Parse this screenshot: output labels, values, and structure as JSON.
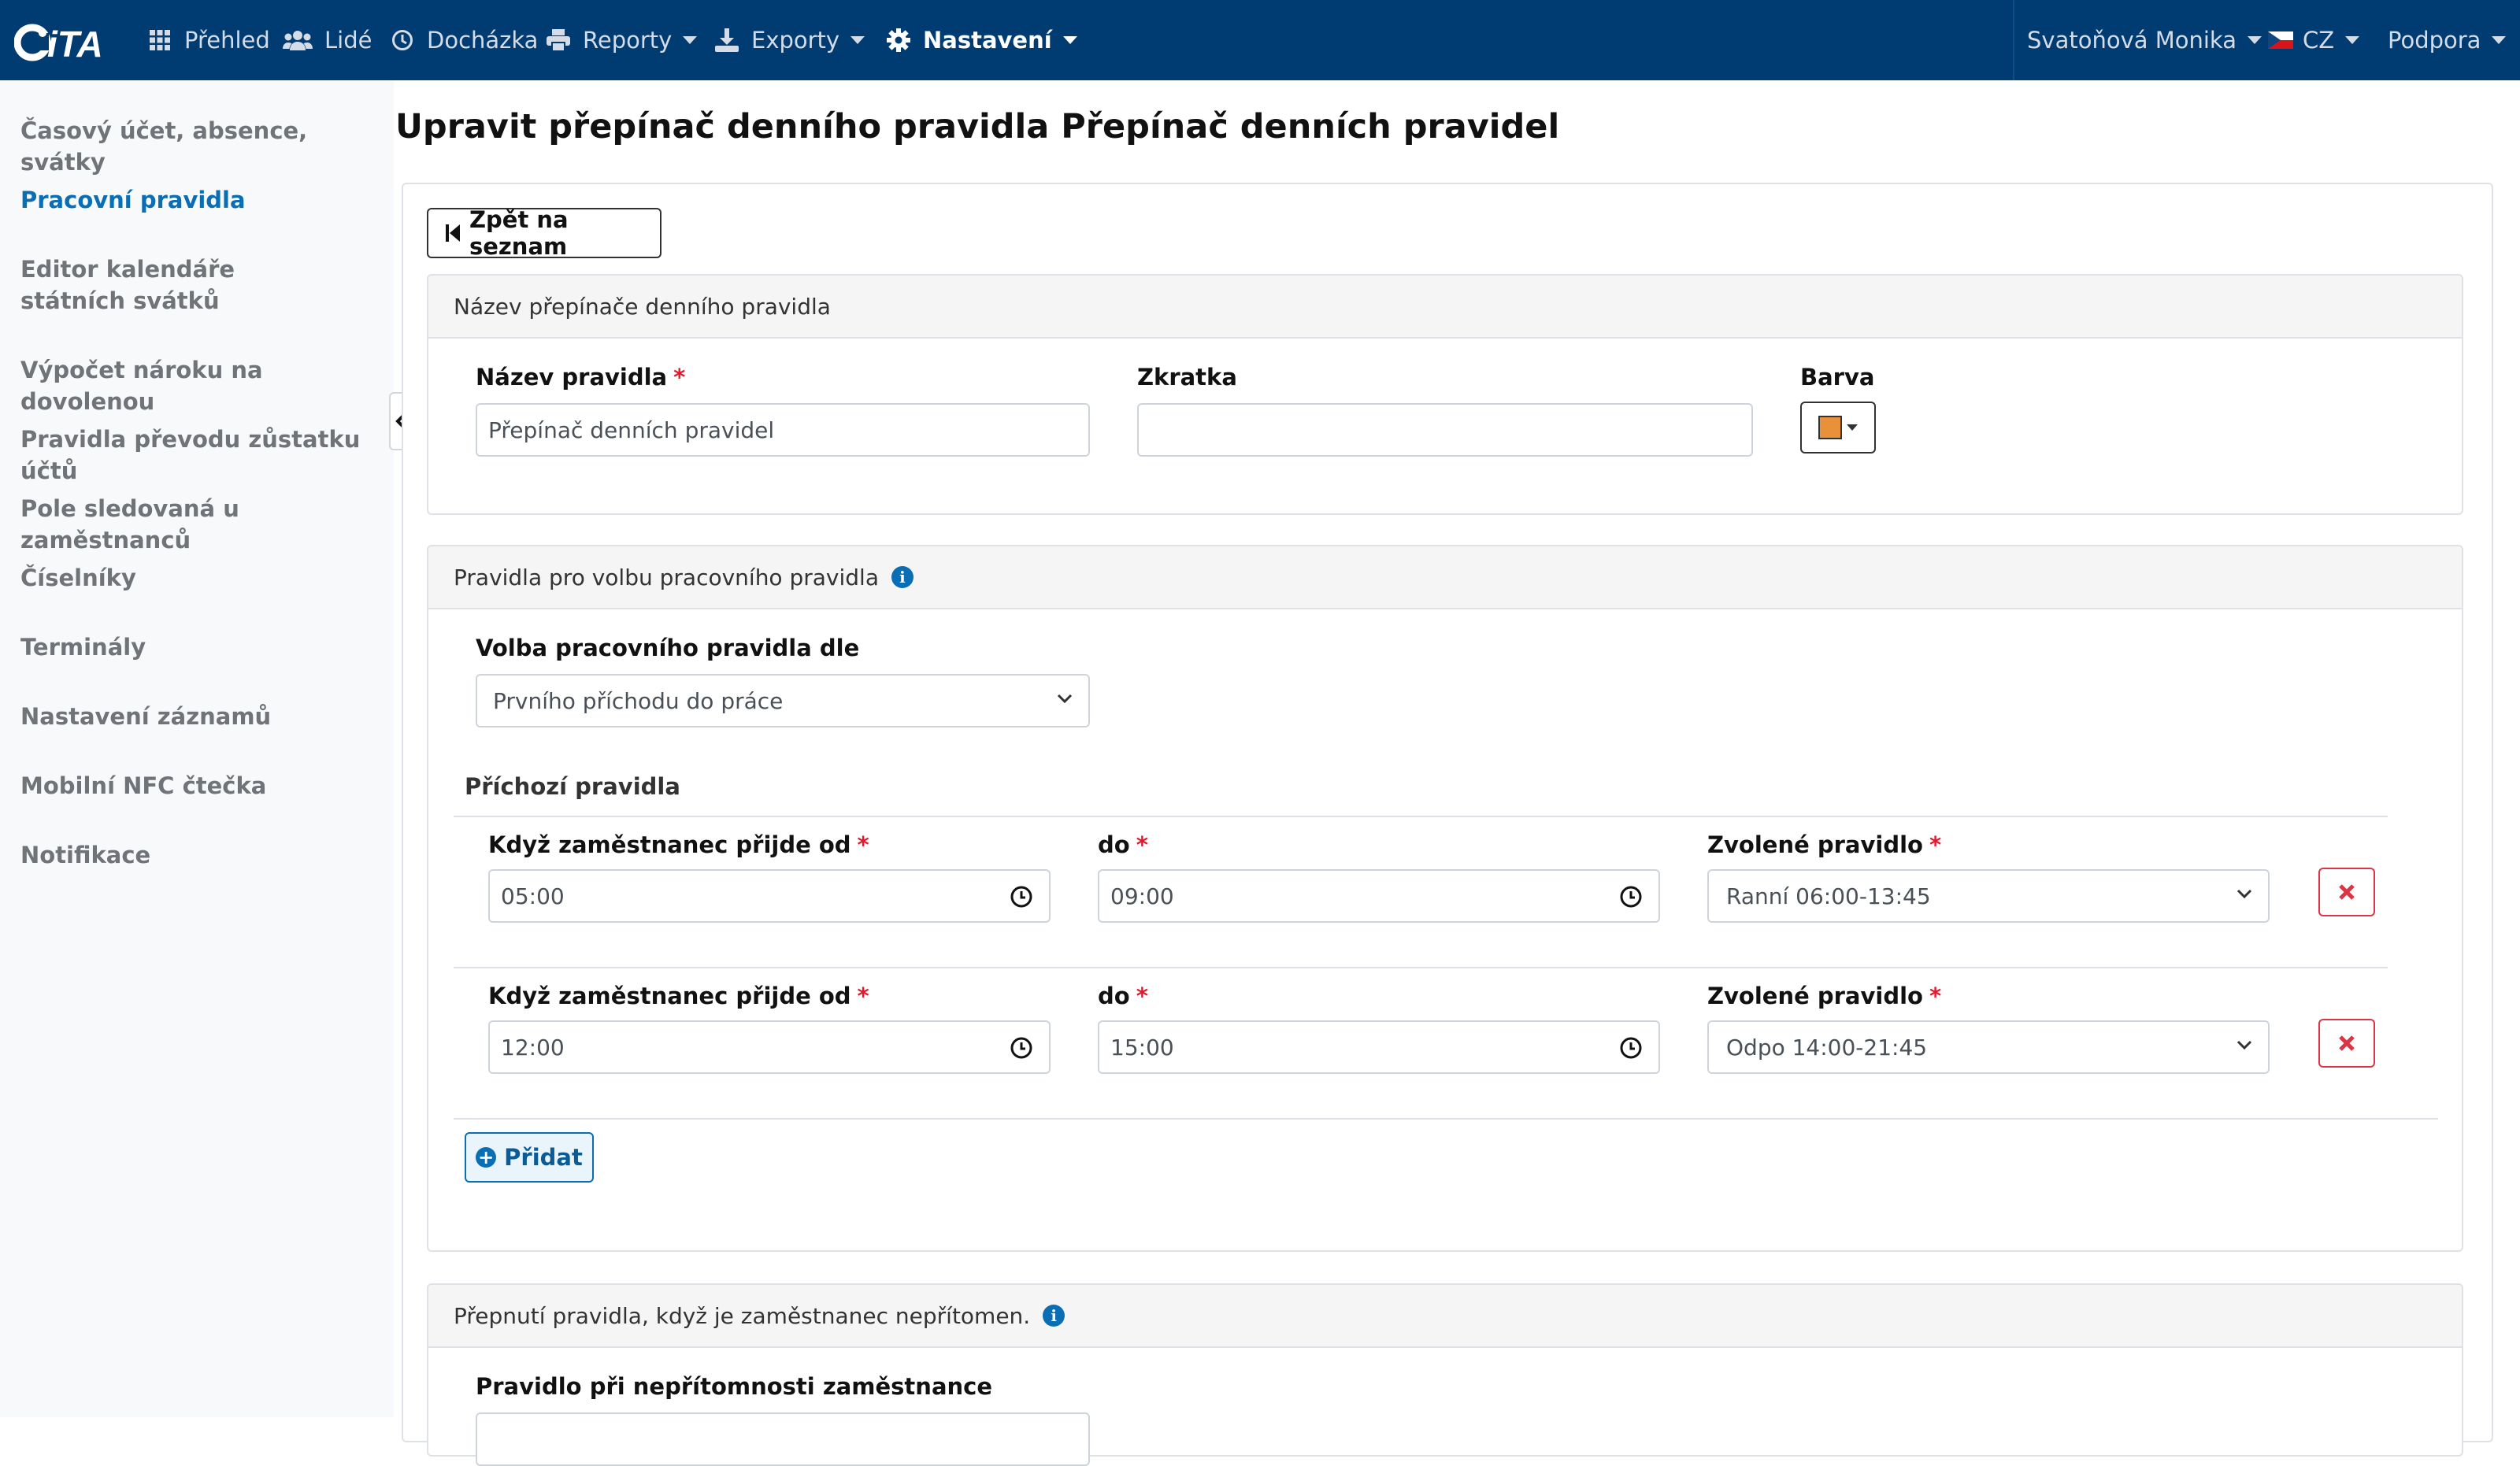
{
  "app": {
    "logo_text": "iTA"
  },
  "nav": {
    "items": [
      {
        "label": "Přehled",
        "icon": "grid-icon"
      },
      {
        "label": "Lidé",
        "icon": "users-icon"
      },
      {
        "label": "Docházka",
        "icon": "clock-icon"
      },
      {
        "label": "Reporty",
        "icon": "print-icon"
      },
      {
        "label": "Exporty",
        "icon": "export-icon"
      },
      {
        "label": "Nastavení",
        "icon": "gear-icon",
        "active": true
      }
    ],
    "user": "Svatoňová Monika",
    "language": "CZ",
    "support": "Podpora"
  },
  "sidebar": {
    "items": [
      {
        "label": "Časový účet, absence, svátky"
      },
      {
        "label": "Pracovní pravidla",
        "active": true
      },
      {
        "label": "Editor kalendáře státních svátků"
      },
      {
        "label": "Výpočet nároku na dovolenou"
      },
      {
        "label": "Pravidla převodu zůstatku účtů"
      },
      {
        "label": "Pole sledovaná u zaměstnanců"
      },
      {
        "label": "Číselníky"
      },
      {
        "label": "Terminály"
      },
      {
        "label": "Nastavení záznamů"
      },
      {
        "label": "Mobilní NFC čtečka"
      },
      {
        "label": "Notifikace"
      }
    ]
  },
  "page": {
    "title": "Upravit přepínač denního pravidla Přepínač denních pravidel",
    "back_button": "Zpět na seznam"
  },
  "name_panel": {
    "header": "Název přepínače denního pravidla",
    "name_label": "Název pravidla",
    "name_value": "Přepínač denních pravidel",
    "abbr_label": "Zkratka",
    "abbr_value": "",
    "color_label": "Barva",
    "color_value": "#e8913a"
  },
  "rules_panel": {
    "header": "Pravidla pro volbu pracovního pravidla",
    "choice_label": "Volba pracovního pravidla dle",
    "choice_value": "Prvního příchodu do práce",
    "arrival_title": "Příchozí pravidla",
    "rows": [
      {
        "from_label": "Když zaměstnanec přijde od",
        "from": "05:00",
        "to_label": "do",
        "to": "09:00",
        "rule_label": "Zvolené pravidlo",
        "rule": "Ranní 06:00-13:45"
      },
      {
        "from_label": "Když zaměstnanec přijde od",
        "from": "12:00",
        "to_label": "do",
        "to": "15:00",
        "rule_label": "Zvolené pravidlo",
        "rule": "Odpo 14:00-21:45"
      }
    ],
    "add_button": "Přidat"
  },
  "absence_panel": {
    "header": "Přepnutí pravidla, když je zaměstnanec nepřítomen.",
    "rule_label": "Pravidlo při nepřítomnosti zaměstnance"
  },
  "colors": {
    "navbar": "#003c71",
    "accent": "#0a6eb4",
    "required": "#e3192f",
    "danger": "#dc3545"
  }
}
